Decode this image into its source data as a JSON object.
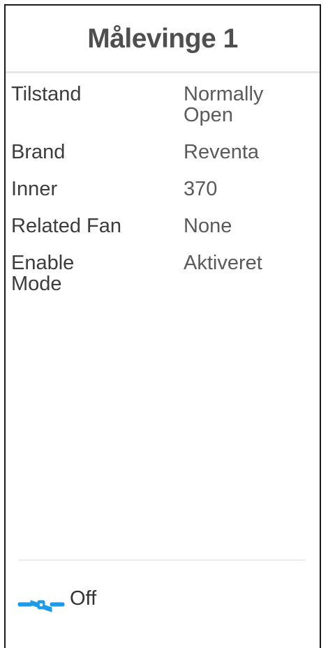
{
  "header": {
    "title": "Målevinge 1"
  },
  "details": [
    {
      "label": "Tilstand",
      "value": "Normally\nOpen"
    },
    {
      "label": "Brand",
      "value": "Reventa"
    },
    {
      "label": "Inner",
      "value": "370"
    },
    {
      "label": "Related Fan",
      "value": "None"
    },
    {
      "label": "Enable\nMode",
      "value": "Aktiveret"
    }
  ],
  "status": {
    "icon": "damper-icon",
    "icon_color": "#1e9be8",
    "text": "Off"
  }
}
